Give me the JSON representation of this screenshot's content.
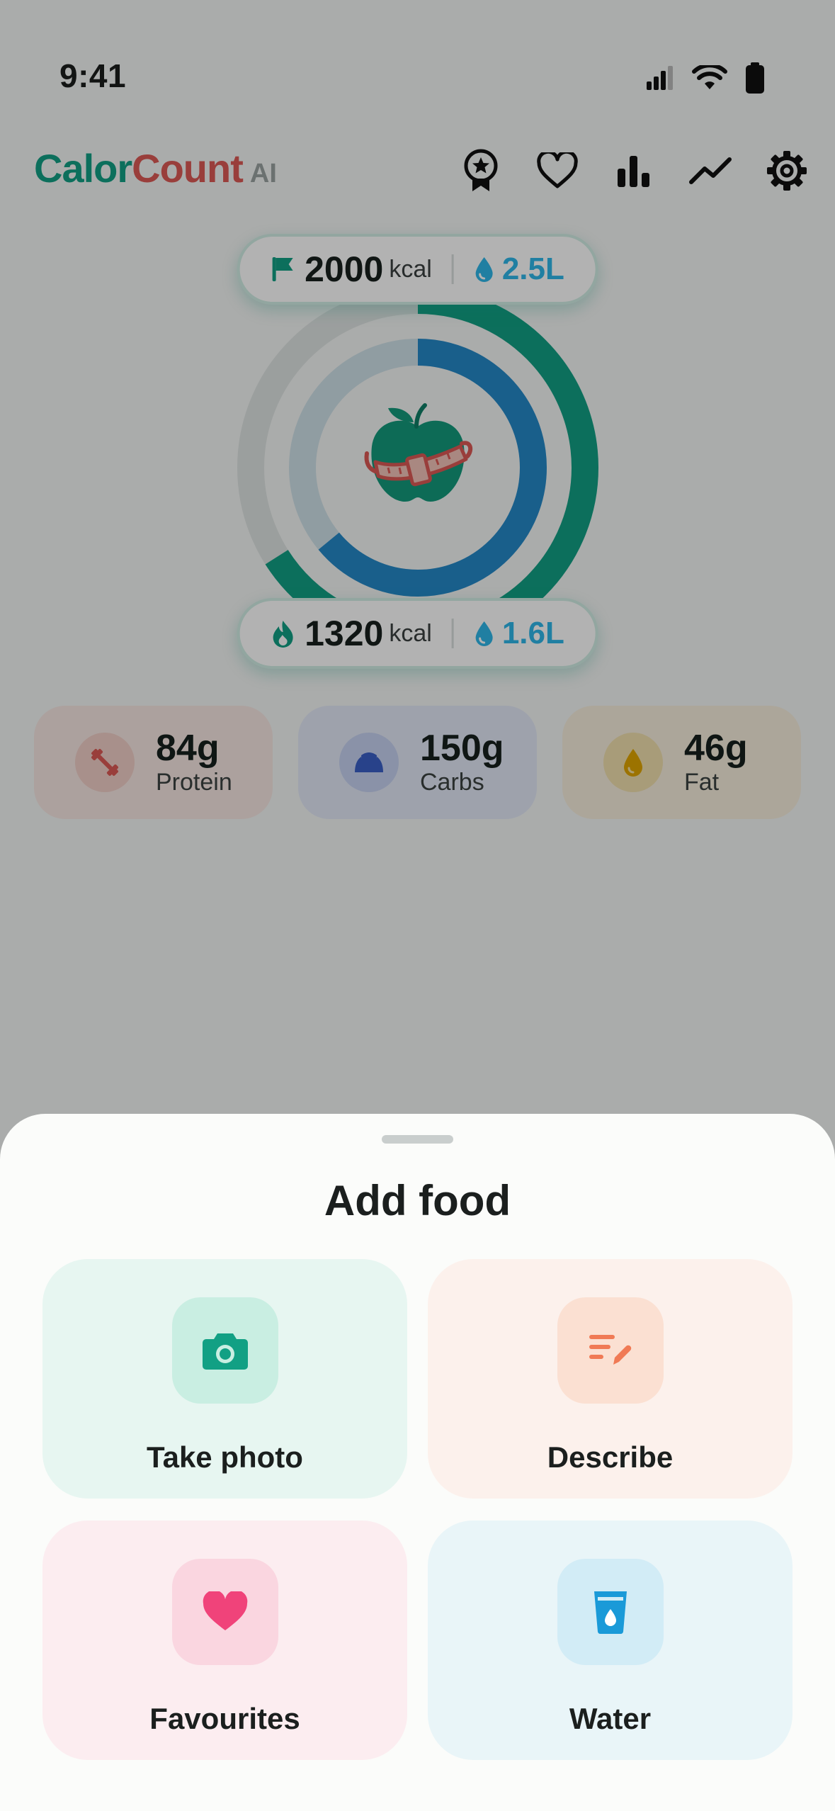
{
  "status_bar": {
    "time": "9:41"
  },
  "header": {
    "logo": {
      "part1": "Calor",
      "part2": "Count",
      "suffix": "AI"
    },
    "icons": [
      "award-icon",
      "heart-icon",
      "bar-chart-icon",
      "trend-line-icon",
      "gear-icon"
    ]
  },
  "goals": {
    "kcal": "2000",
    "kcal_unit": "kcal",
    "water": "2.5L"
  },
  "consumed": {
    "kcal": "1320",
    "kcal_unit": "kcal",
    "water": "1.6L"
  },
  "ring": {
    "calories_progress": 0.66,
    "water_progress": 0.64
  },
  "macros": [
    {
      "value": "84g",
      "label": "Protein",
      "icon": "dumbbell-icon"
    },
    {
      "value": "150g",
      "label": "Carbs",
      "icon": "croissant-icon"
    },
    {
      "value": "46g",
      "label": "Fat",
      "icon": "drop-icon"
    }
  ],
  "sheet": {
    "title": "Add food",
    "options": [
      {
        "label": "Take photo",
        "icon": "camera-icon"
      },
      {
        "label": "Describe",
        "icon": "describe-icon"
      },
      {
        "label": "Favourites",
        "icon": "heart-icon"
      },
      {
        "label": "Water",
        "icon": "water-glass-icon"
      }
    ]
  },
  "colors": {
    "accent_green": "#12a084",
    "accent_red": "#dc5a55",
    "water_blue": "#2eb6e8",
    "ring_blue": "#2489c8"
  }
}
